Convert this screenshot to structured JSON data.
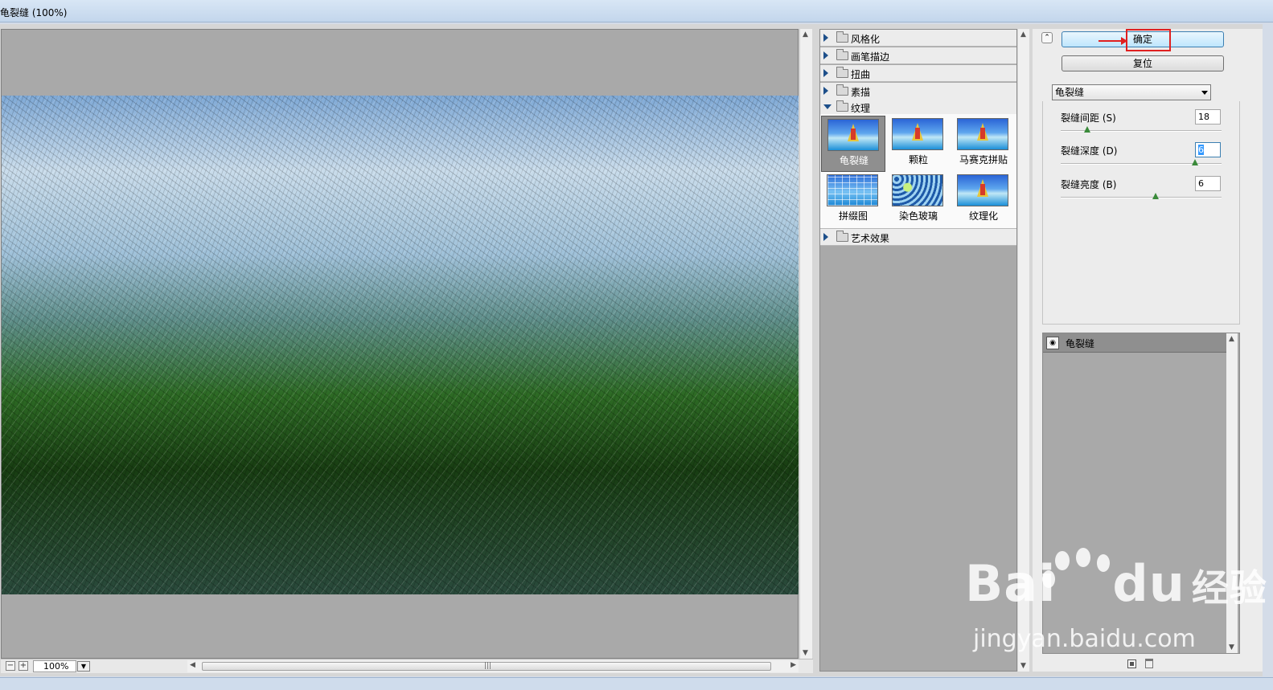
{
  "window": {
    "title": "龟裂缝 (100%)"
  },
  "preview": {
    "zoom": "100%"
  },
  "filter_tree": {
    "categories": [
      {
        "label": "风格化",
        "open": false
      },
      {
        "label": "画笔描边",
        "open": false
      },
      {
        "label": "扭曲",
        "open": false
      },
      {
        "label": "素描",
        "open": false
      },
      {
        "label": "纹理",
        "open": true
      },
      {
        "label": "艺术效果",
        "open": false
      }
    ],
    "texture_filters": [
      {
        "label": "龟裂缝",
        "selected": true
      },
      {
        "label": "颗粒",
        "selected": false
      },
      {
        "label": "马赛克拼贴",
        "selected": false
      },
      {
        "label": "拼缀图",
        "selected": false
      },
      {
        "label": "染色玻璃",
        "selected": false
      },
      {
        "label": "纹理化",
        "selected": false
      }
    ]
  },
  "buttons": {
    "ok": "确定",
    "reset": "复位"
  },
  "filter_select": {
    "value": "龟裂缝"
  },
  "params": [
    {
      "label": "裂缝间距 (S)",
      "value": "18",
      "fraction": 0.17
    },
    {
      "label": "裂缝深度 (D)",
      "value": "6",
      "fraction": 0.85
    },
    {
      "label": "裂缝亮度 (B)",
      "value": "6",
      "fraction": 0.6
    }
  ],
  "layers": [
    {
      "name": "龟裂缝"
    }
  ],
  "watermark": {
    "brand": "Bai",
    "brand2": "du",
    "suffix": "经验",
    "url": "jingyan.baidu.com"
  },
  "colors": {
    "highlight": "#e02020",
    "ok_button": "#bee6fd",
    "panel_gray": "#a9a9a9"
  },
  "icons": [
    "collapse-icon",
    "zoom-out-icon",
    "zoom-in-icon",
    "eye-icon",
    "new-layer-icon",
    "trash-icon"
  ]
}
